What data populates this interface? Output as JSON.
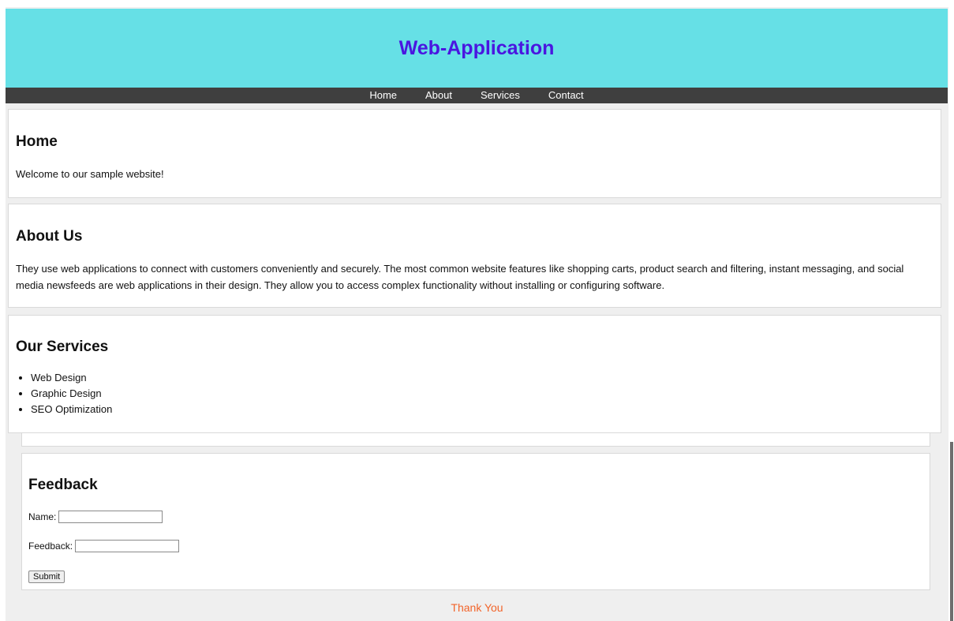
{
  "header": {
    "title": "Web-Application"
  },
  "nav": {
    "items": [
      "Home",
      "About",
      "Services",
      "Contact"
    ]
  },
  "home": {
    "heading": "Home",
    "text": "Welcome to our sample website!"
  },
  "about": {
    "heading": "About Us",
    "text": "They use web applications to connect with customers conveniently and securely. The most common website features like shopping carts, product search and filtering, instant messaging, and social media newsfeeds are web applications in their design. They allow you to access complex functionality without installing or configuring software."
  },
  "services": {
    "heading": "Our Services",
    "items": [
      "Web Design",
      "Graphic Design",
      "SEO Optimization"
    ]
  },
  "feedback": {
    "heading": "Feedback",
    "name_label": "Name:",
    "name_value": "",
    "feedback_label": "Feedback:",
    "feedback_value": "",
    "submit_label": "Submit"
  },
  "footer": {
    "thanks": "Thank You"
  },
  "colors": {
    "header_bg": "#66e0e6",
    "title": "#4a16e0",
    "nav_bg": "#3f3f3f",
    "thanks": "#f2642a"
  }
}
